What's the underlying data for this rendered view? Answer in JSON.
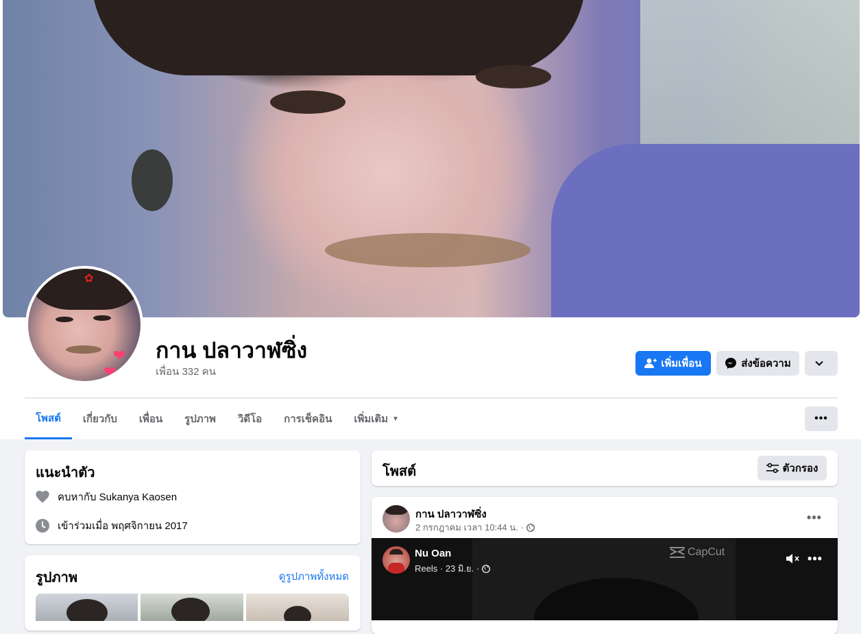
{
  "profile": {
    "name": "กาน ปลาวาฬซิ่ง",
    "friends": "เพื่อน 332 คน"
  },
  "actions": {
    "add_friend": "เพิ่มเพื่อน",
    "message": "ส่งข้อความ"
  },
  "tabs": [
    {
      "label": "โพสต์",
      "active": true
    },
    {
      "label": "เกี่ยวกับ",
      "active": false
    },
    {
      "label": "เพื่อน",
      "active": false
    },
    {
      "label": "รูปภาพ",
      "active": false
    },
    {
      "label": "วิดีโอ",
      "active": false
    },
    {
      "label": "การเช็คอิน",
      "active": false
    },
    {
      "label": "เพิ่มเติม",
      "active": false
    }
  ],
  "intro": {
    "title": "แนะนำตัว",
    "relationship": "คบหากับ Sukanya Kaosen",
    "joined": "เข้าร่วมเมื่อ พฤศจิกายน 2017"
  },
  "photos": {
    "title": "รูปภาพ",
    "see_all": "ดูรูปภาพทั้งหมด"
  },
  "posts_header": {
    "title": "โพสต์",
    "filter": "ตัวกรอง"
  },
  "post": {
    "author": "กาน ปลาวาฬซิ่ง",
    "meta": "2 กรกฎาคม เวลา 10:44 น. ·",
    "shared": {
      "author": "Nu Oan",
      "meta": "Reels · 23 มิ.ย. ·",
      "watermark": "CapCut"
    }
  },
  "colors": {
    "accent": "#1877f2",
    "page_bg": "#f0f2f5",
    "secondary_button": "#e4e6eb"
  }
}
